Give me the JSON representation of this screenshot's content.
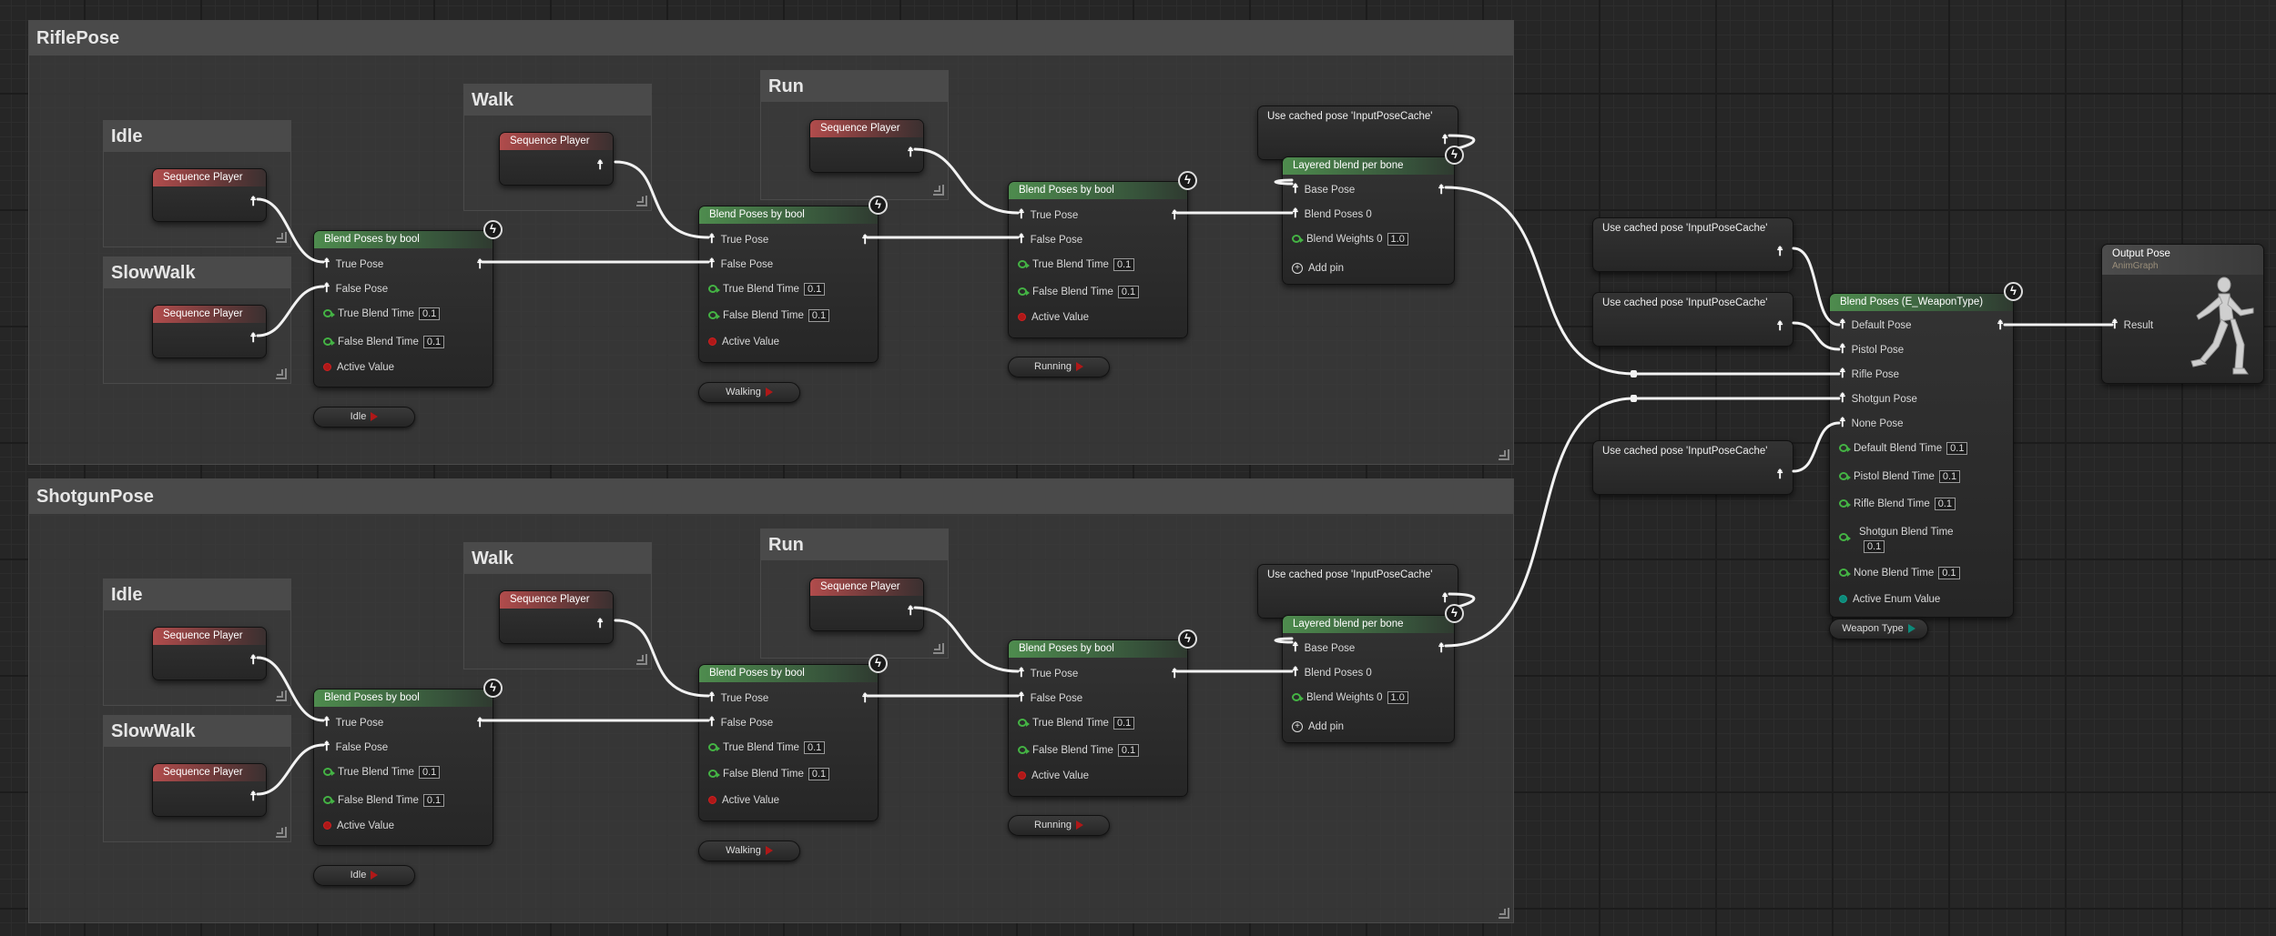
{
  "comments": {
    "rifle": "RiflePose",
    "shotgun": "ShotgunPose",
    "idle": "Idle",
    "slowwalk": "SlowWalk",
    "walk": "Walk",
    "run": "Run"
  },
  "nodes": {
    "sequence_player": "Sequence Player",
    "blend_bool": "Blend Poses by bool",
    "cached_pose": "Use cached pose 'InputPoseCache'",
    "layered_blend": "Layered blend per bone",
    "blend_enum": "Blend Poses (E_WeaponType)",
    "output_pose": "Output Pose",
    "output_sub": "AnimGraph"
  },
  "pins": {
    "true_pose": "True Pose",
    "false_pose": "False Pose",
    "true_blend_time": "True Blend Time",
    "false_blend_time": "False Blend Time",
    "active_value": "Active Value",
    "base_pose": "Base Pose",
    "blend_poses_0": "Blend Poses 0",
    "blend_weights_0": "Blend Weights 0",
    "add_pin": "Add pin",
    "default_pose": "Default Pose",
    "pistol_pose": "Pistol Pose",
    "rifle_pose": "Rifle Pose",
    "shotgun_pose": "Shotgun Pose",
    "none_pose": "None Pose",
    "default_blend_time": "Default Blend Time",
    "pistol_blend_time": "Pistol Blend Time",
    "rifle_blend_time": "Rifle Blend Time",
    "shotgun_blend_time": "Shotgun Blend Time",
    "none_blend_time": "None Blend Time",
    "active_enum_value": "Active Enum Value",
    "result": "Result"
  },
  "values": {
    "blend_time": "0.1",
    "blend_weight": "1.0"
  },
  "variables": {
    "idle": "Idle",
    "walking": "Walking",
    "running": "Running",
    "weapon_type": "Weapon Type"
  },
  "colors": {
    "pose_wire": "#ffffff",
    "bool_pin": "#b01818",
    "float_pin": "#44b344",
    "enum_pin": "#0d8a7a",
    "sequence_header": "#b14c4c",
    "blend_header": "#4e8c4e"
  },
  "icons": {
    "pose_pin": "pose-person-icon",
    "fast_path": "lightning-icon",
    "resize": "resize-grip-icon",
    "character": "mannequin-icon"
  }
}
